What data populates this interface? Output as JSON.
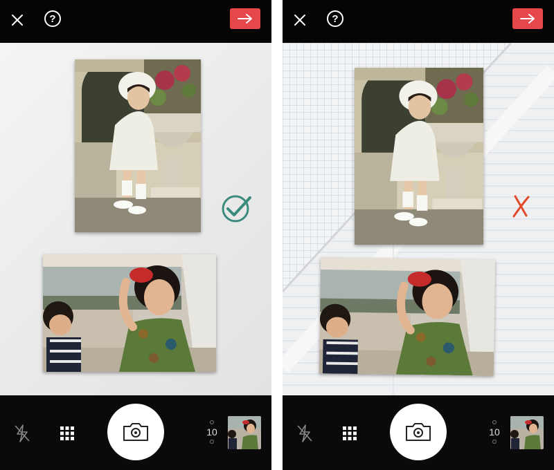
{
  "colors": {
    "accent_red": "#e5474b",
    "check_teal": "#3a8a7e",
    "cross_red": "#e2482a",
    "bar_black": "#050505"
  },
  "icons": {
    "close": "close-icon",
    "help": "help-icon",
    "next": "arrow-right-icon",
    "flash": "flash-off-icon",
    "grid": "grid-icon",
    "shutter": "camera-icon",
    "check": "check-circle-icon",
    "cross": "cross-icon"
  },
  "left": {
    "help_symbol": "?",
    "timer": "10",
    "status": "correct"
  },
  "right": {
    "help_symbol": "?",
    "timer": "10",
    "status": "incorrect"
  }
}
